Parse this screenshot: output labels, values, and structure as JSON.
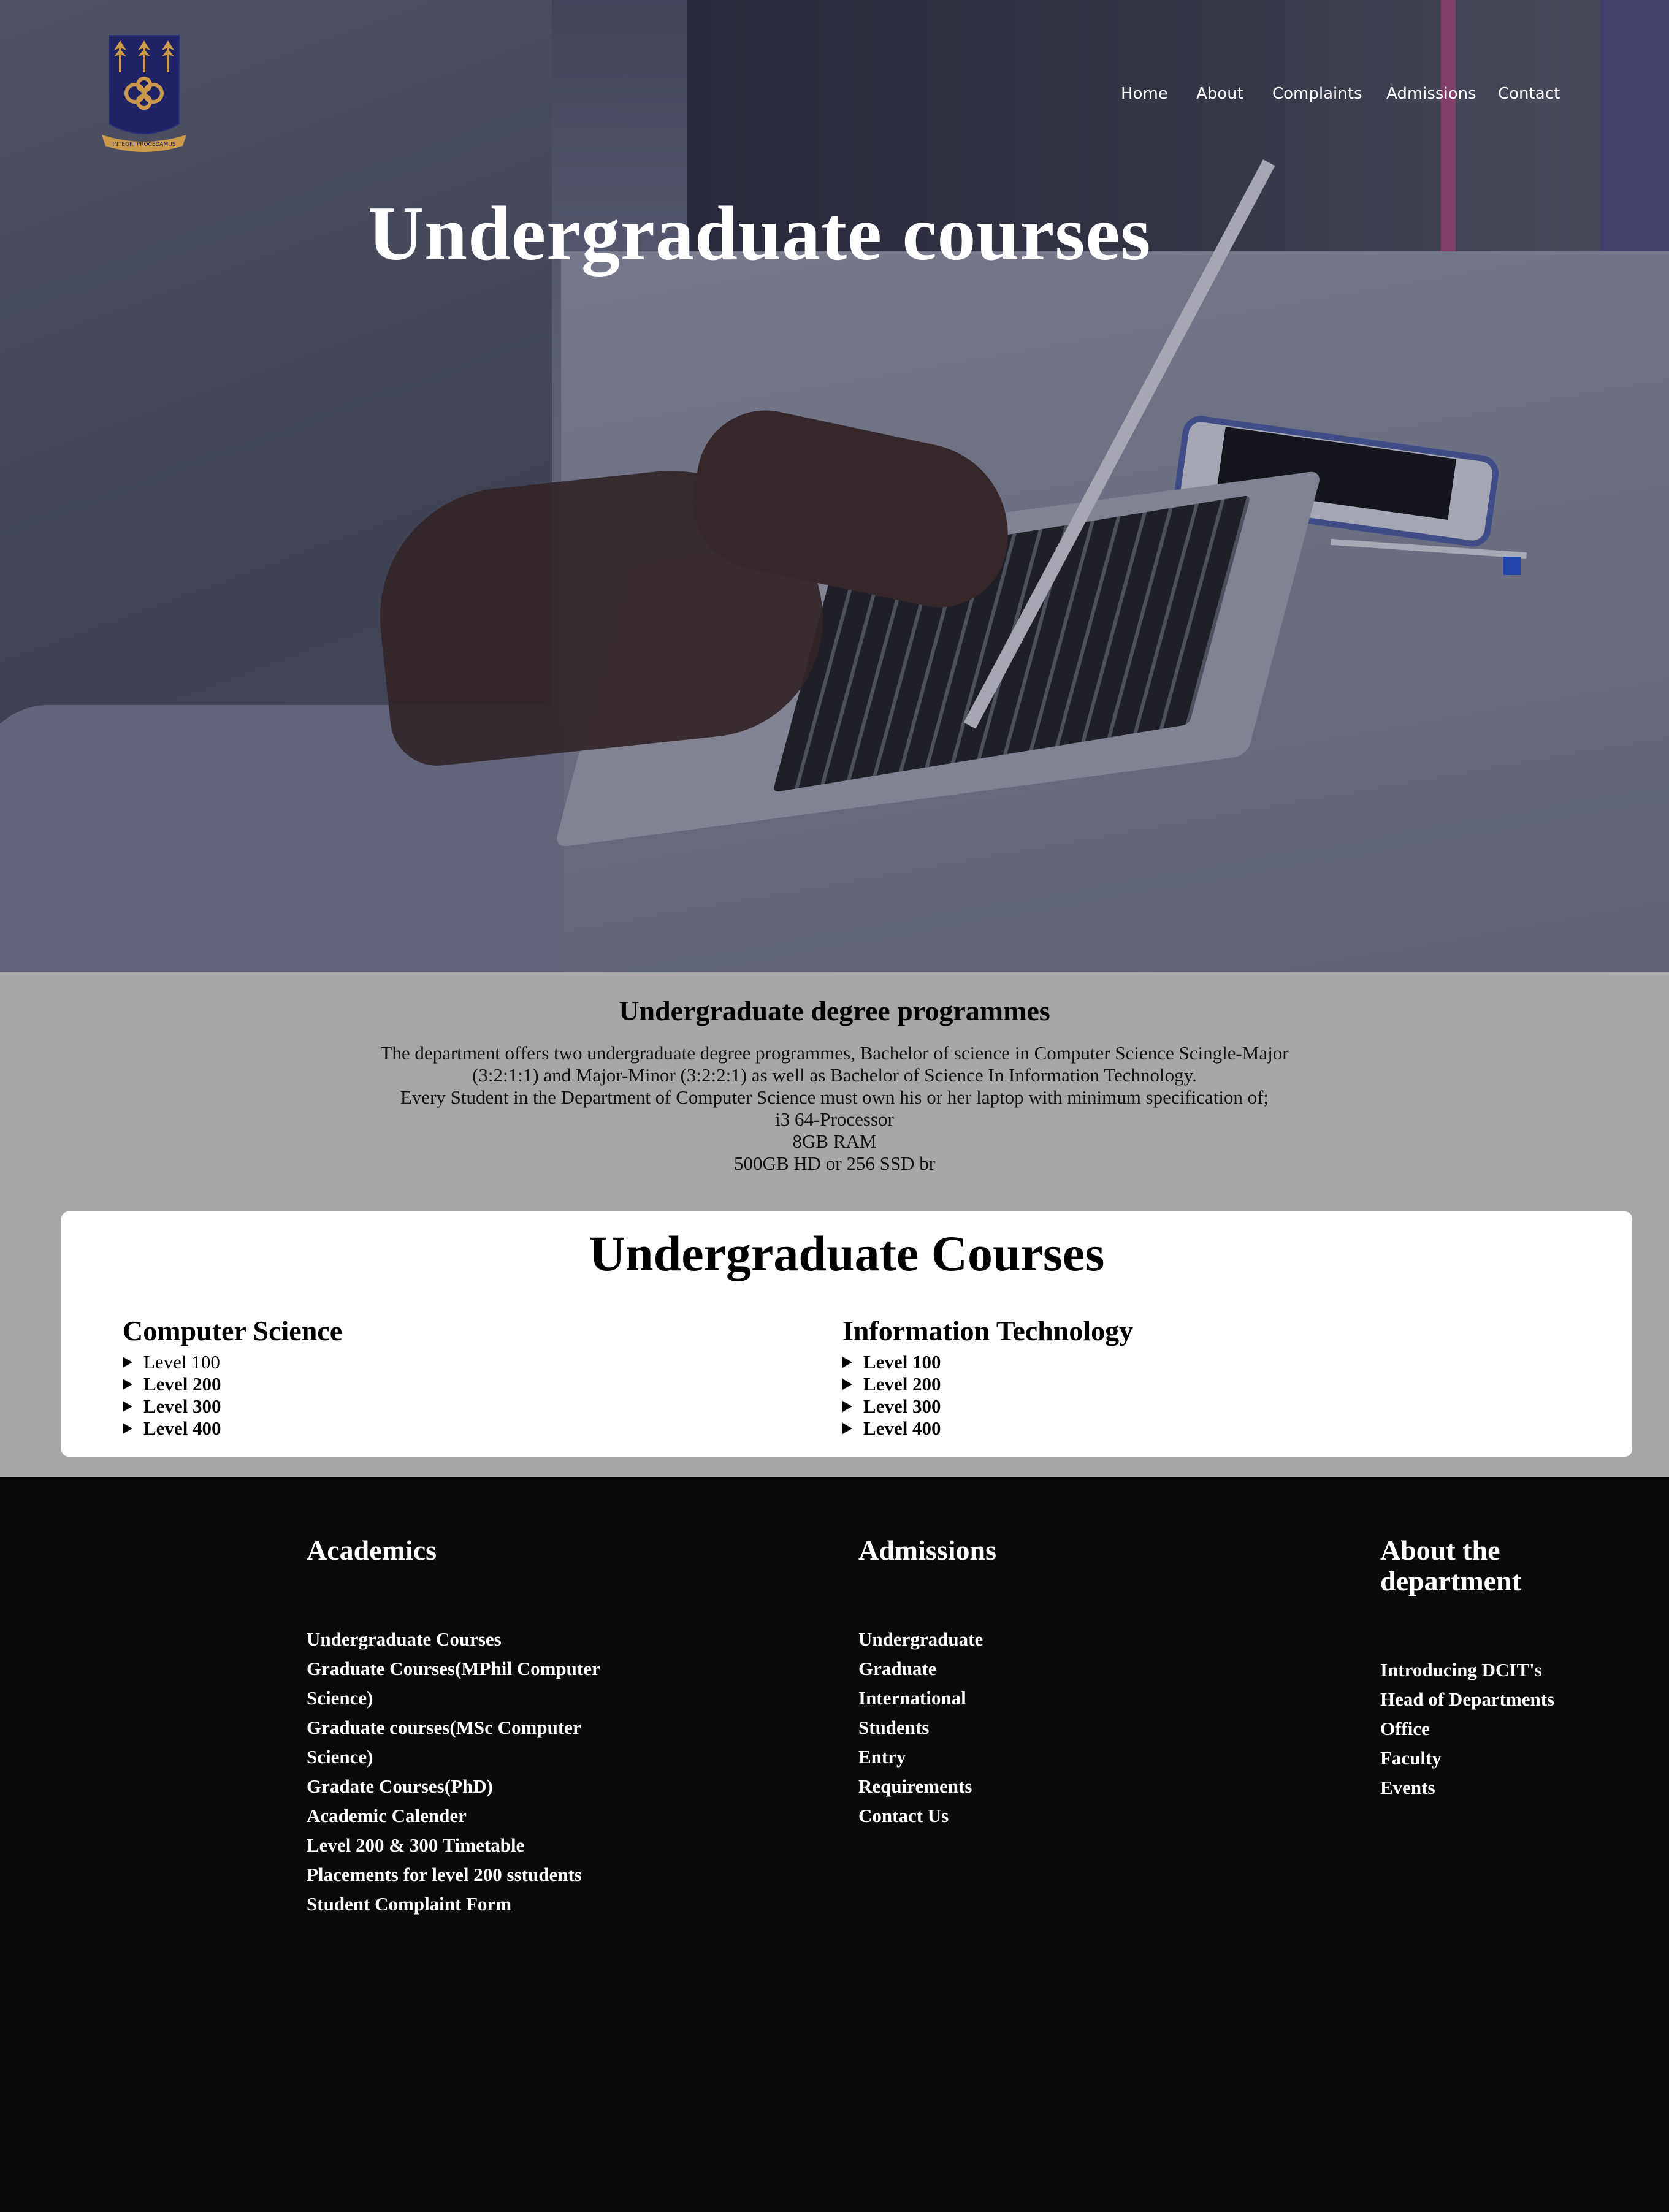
{
  "brand": {
    "logo_icon": "university-crest-icon",
    "logo_motto": "INTEGRI PROCEDAMUS",
    "colors": {
      "crest_blue": "#1f2366",
      "crest_gold": "#c99a4a"
    }
  },
  "nav": {
    "items": [
      {
        "label": "Home"
      },
      {
        "label": "About"
      },
      {
        "label": "Complaints"
      },
      {
        "label": "Admissions"
      },
      {
        "label": "Contact"
      }
    ]
  },
  "hero": {
    "title": "Undergraduate courses",
    "image": "student-typing-on-laptop"
  },
  "programmes": {
    "heading": "Undergraduate degree programmes",
    "lines": [
      "The department offers two undergraduate degree programmes, Bachelor of science in Computer Science Scingle-Major",
      "(3:2:1:1) and Major-Minor (3:2:2:1) as well as Bachelor of Science In Information Technology.",
      "Every Student in the Department of Computer Science must own his or her laptop with minimum specification of;",
      "i3 64-Processor",
      "8GB RAM",
      "500GB HD or 256 SSD br"
    ]
  },
  "courses": {
    "title": "Undergraduate Courses",
    "columns": [
      {
        "heading": "Computer Science",
        "levels": [
          {
            "label": "Level 100",
            "bold": false
          },
          {
            "label": "Level 200",
            "bold": true
          },
          {
            "label": "Level 300",
            "bold": true
          },
          {
            "label": "Level 400",
            "bold": true
          }
        ]
      },
      {
        "heading": "Information Technology",
        "levels": [
          {
            "label": "Level 100",
            "bold": true
          },
          {
            "label": "Level 200",
            "bold": true
          },
          {
            "label": "Level 300",
            "bold": true
          },
          {
            "label": "Level 400",
            "bold": true
          }
        ]
      }
    ]
  },
  "footer": {
    "academics": {
      "heading": "Academics",
      "links": [
        "Undergraduate Courses",
        "Graduate Courses(MPhil Computer",
        "Science)",
        "Graduate courses(MSc Computer",
        "Science)",
        "Gradate Courses(PhD)",
        "Academic Calender",
        "Level 200 & 300 Timetable",
        "Placements for level 200 sstudents",
        "Student Complaint Form"
      ]
    },
    "admissions": {
      "heading": "Admissions",
      "links": [
        "Undergraduate",
        "Graduate",
        "International",
        "Students",
        "Entry",
        "Requirements",
        "Contact Us"
      ]
    },
    "about": {
      "heading_line1": "About the",
      "heading_line2": "department",
      "links": [
        "Introducing DCIT's",
        "Head of Departments",
        "Office",
        "Faculty",
        "Events"
      ]
    }
  }
}
